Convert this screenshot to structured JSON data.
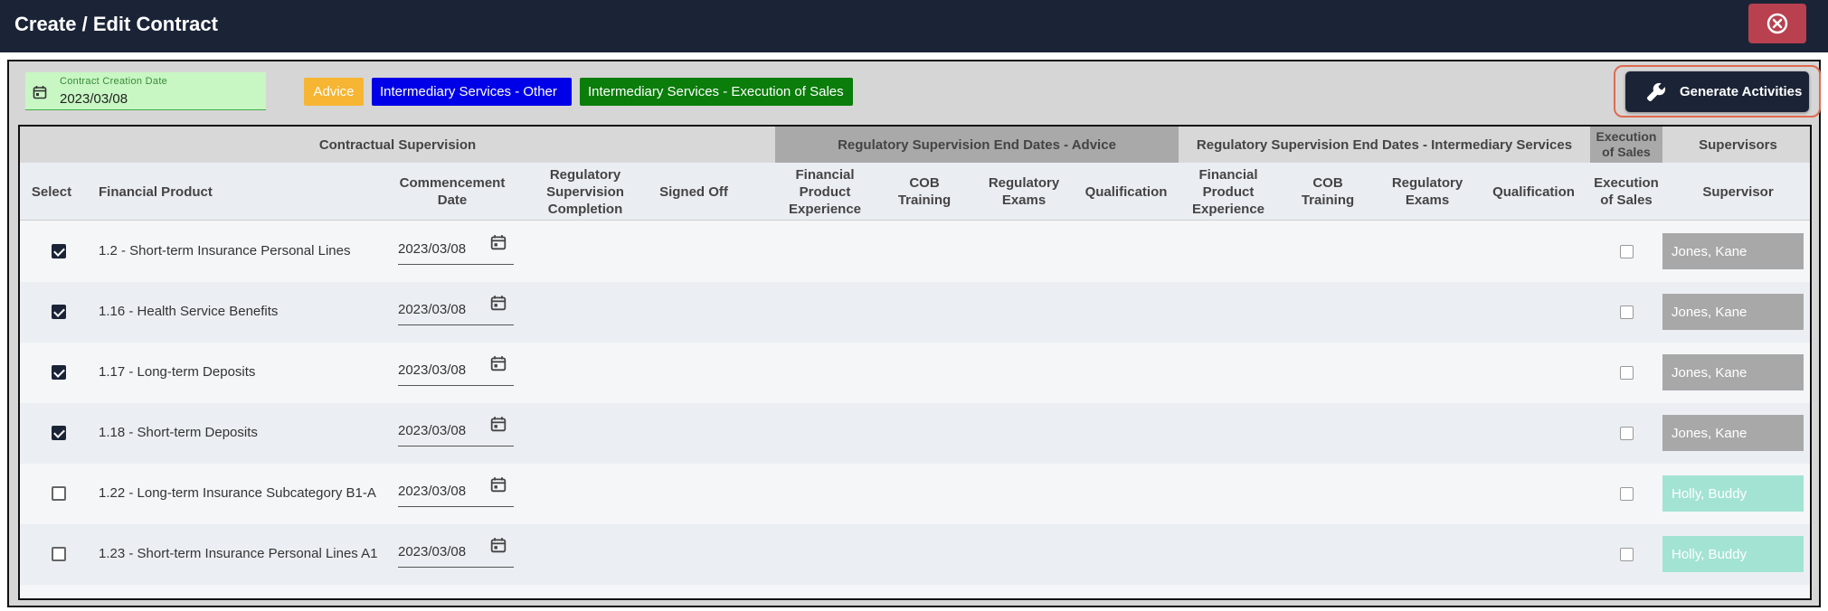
{
  "window": {
    "title": "Create / Edit Contract"
  },
  "contract_date": {
    "label": "Contract Creation Date",
    "value": "2023/03/08"
  },
  "chips": [
    {
      "label": "Advice",
      "color": "#f6b532"
    },
    {
      "label": "Intermediary Services - Other",
      "color": "#0000e8"
    },
    {
      "label": "Intermediary Services - Execution of Sales",
      "color": "#0a7d0a"
    }
  ],
  "generate_button": {
    "label": "Generate Activities"
  },
  "table": {
    "groups": {
      "contractual": "Contractual Supervision",
      "advice": "Regulatory Supervision End Dates - Advice",
      "intermediary": "Regulatory Supervision End Dates - Intermediary Services",
      "execution": "Execution of Sales",
      "supervisors": "Supervisors"
    },
    "columns": {
      "select": "Select",
      "product": "Financial Product",
      "commencement": "Commencement Date",
      "completion": "Regulatory Supervision Completion",
      "signed_off": "Signed Off",
      "adv_experience": "Financial Product Experience",
      "adv_cob": "COB Training",
      "adv_exams": "Regulatory Exams",
      "adv_qualification": "Qualification",
      "int_experience": "Financial Product Experience",
      "int_cob": "COB Training",
      "int_exams": "Regulatory Exams",
      "int_qualification": "Qualification",
      "exec_sales": "Execution of Sales",
      "supervisor": "Supervisor"
    },
    "rows": [
      {
        "selected": true,
        "product": "1.2 - Short-term Insurance Personal Lines",
        "date": "2023/03/08",
        "supervisor": "Jones, Kane",
        "supervisor_color": "#a8a8a8"
      },
      {
        "selected": true,
        "product": "1.16 - Health Service Benefits",
        "date": "2023/03/08",
        "supervisor": "Jones, Kane",
        "supervisor_color": "#a8a8a8"
      },
      {
        "selected": true,
        "product": "1.17 - Long-term Deposits",
        "date": "2023/03/08",
        "supervisor": "Jones, Kane",
        "supervisor_color": "#a8a8a8"
      },
      {
        "selected": true,
        "product": "1.18 - Short-term Deposits",
        "date": "2023/03/08",
        "supervisor": "Jones, Kane",
        "supervisor_color": "#a8a8a8"
      },
      {
        "selected": false,
        "product": "1.22 - Long-term Insurance Subcategory B1-A",
        "date": "2023/03/08",
        "supervisor": "Holly, Buddy",
        "supervisor_color": "#a3e3d4"
      },
      {
        "selected": false,
        "product": "1.23 - Short-term Insurance Personal Lines A1",
        "date": "2023/03/08",
        "supervisor": "Holly, Buddy",
        "supervisor_color": "#a3e3d4"
      }
    ]
  },
  "icons": {
    "close": "close-circle-icon",
    "calendar": "calendar-icon",
    "wrench": "wrench-icon"
  }
}
